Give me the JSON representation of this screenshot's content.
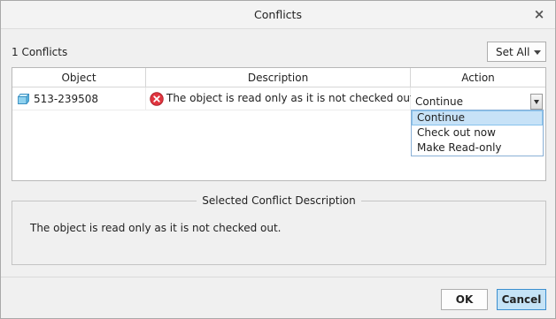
{
  "window": {
    "title": "Conflicts",
    "close_icon": "close-icon"
  },
  "toolbar": {
    "conflict_count": "1 Conflicts",
    "set_all_label": "Set All"
  },
  "table": {
    "columns": [
      "Object",
      "Description",
      "Action"
    ],
    "rows": [
      {
        "object": "513-239508",
        "object_icon": "part-icon",
        "status_icon": "error-icon",
        "description": "The object is read only as it is not checked out.",
        "action": "Continue"
      }
    ]
  },
  "action_dropdown": {
    "options": [
      "Continue",
      "Check out now",
      "Make Read-only"
    ],
    "selected": "Continue"
  },
  "selected_description": {
    "title": "Selected Conflict Description",
    "text": "The object is read only as it is not checked out."
  },
  "buttons": {
    "ok": "OK",
    "cancel": "Cancel"
  },
  "colors": {
    "error": "#e0353f",
    "selection": "#c7e2f7",
    "default_button": "#c5e3f6"
  }
}
